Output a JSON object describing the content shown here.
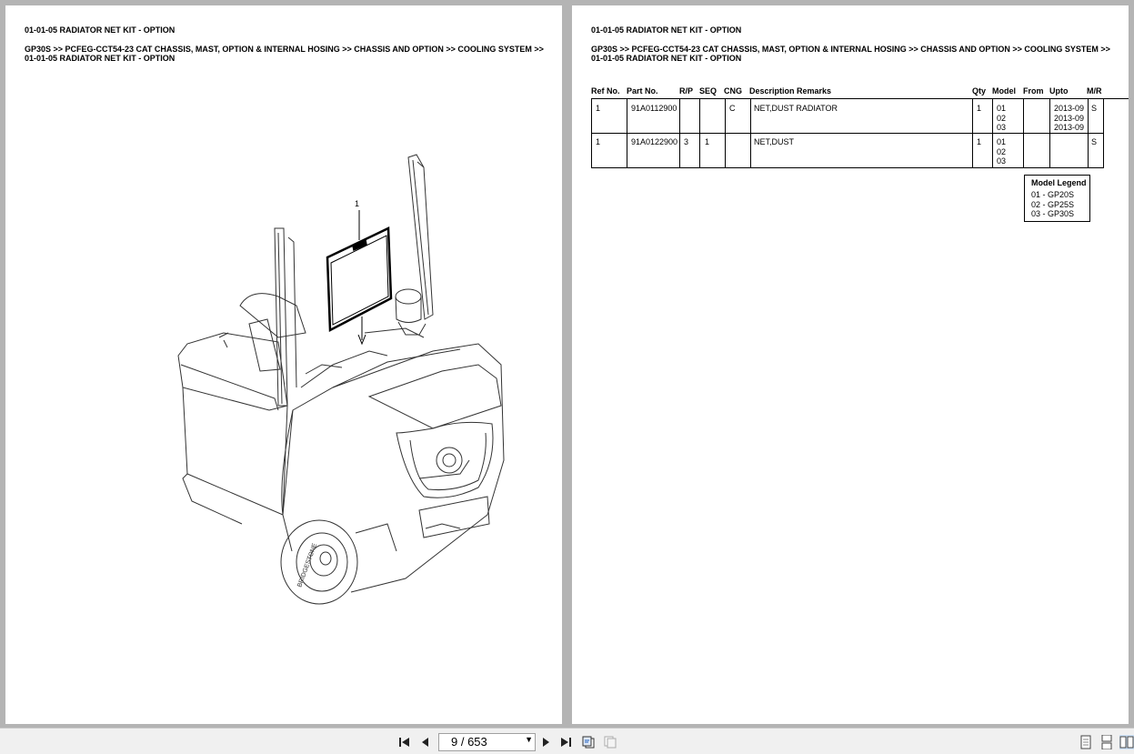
{
  "left_page": {
    "title": "01-01-05 RADIATOR NET KIT - OPTION",
    "breadcrumb_line1": "GP30S >> PCFEG-CCT54-23 CAT CHASSIS, MAST, OPTION & INTERNAL HOSING >> CHASSIS AND OPTION >> COOLING SYSTEM >>",
    "breadcrumb_line2": "01-01-05 RADIATOR NET KIT - OPTION",
    "callout": "1",
    "tire_text": "BRIDGESTONE"
  },
  "right_page": {
    "title": "01-01-05 RADIATOR NET KIT - OPTION",
    "breadcrumb_line1": "GP30S >> PCFEG-CCT54-23 CAT CHASSIS, MAST, OPTION & INTERNAL HOSING >> CHASSIS AND OPTION >> COOLING SYSTEM >>",
    "breadcrumb_line2": "01-01-05 RADIATOR NET KIT - OPTION",
    "headers": {
      "ref": "Ref No.",
      "part": "Part No.",
      "rp": "R/P",
      "seq": "SEQ",
      "cng": "CNG",
      "desc": "Description Remarks",
      "qty": "Qty",
      "model": "Model",
      "from": "From",
      "upto": "Upto",
      "mr": "M/R"
    },
    "rows": [
      {
        "ref": "1",
        "part": "91A0112900",
        "rp": "",
        "seq": "",
        "cng": "C",
        "desc": "NET,DUST RADIATOR",
        "qty": "1",
        "models": [
          "01",
          "02",
          "03"
        ],
        "from": "",
        "upto": [
          "2013-09",
          "2013-09",
          "2013-09"
        ],
        "mr": "S"
      },
      {
        "ref": "1",
        "part": "91A0122900",
        "rp": "3",
        "seq": "1",
        "cng": "",
        "desc": "NET,DUST",
        "qty": "1",
        "models": [
          "01",
          "02",
          "03"
        ],
        "from": "",
        "upto": [
          "",
          "",
          ""
        ],
        "mr": "S"
      }
    ],
    "legend": {
      "title": "Model Legend",
      "items": [
        "01 - GP20S",
        "02 - GP25S",
        "03 - GP30S"
      ]
    }
  },
  "toolbar": {
    "page_indicator": "9 / 653"
  }
}
